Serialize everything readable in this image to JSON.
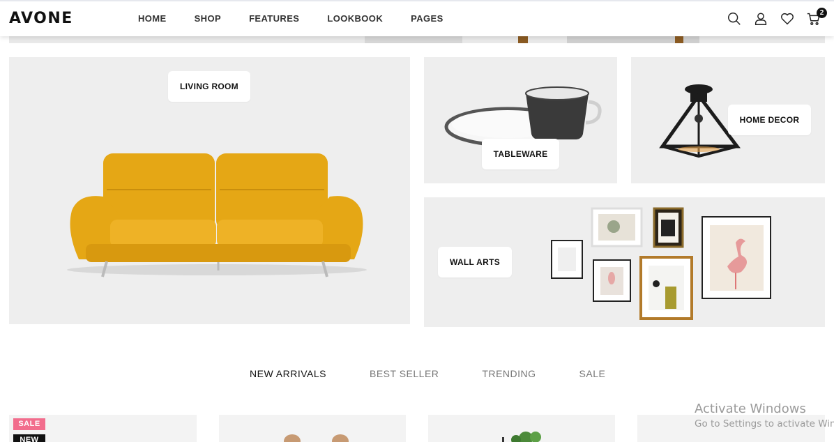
{
  "brand": {
    "logo": "AVONE"
  },
  "nav": [
    {
      "label": "HOME"
    },
    {
      "label": "SHOP"
    },
    {
      "label": "FEATURES"
    },
    {
      "label": "LOOKBOOK"
    },
    {
      "label": "PAGES"
    }
  ],
  "header_icons": [
    "search-icon",
    "user-icon",
    "heart-icon",
    "cart-icon"
  ],
  "cart": {
    "count": "2"
  },
  "categories": {
    "living_room": "LIVING ROOM",
    "tableware": "TABLEWARE",
    "home_decor": "HOME DECOR",
    "wall_arts": "WALL ARTS"
  },
  "tabs": [
    {
      "label": "NEW ARRIVALS",
      "active": true
    },
    {
      "label": "BEST SELLER",
      "active": false
    },
    {
      "label": "TRENDING",
      "active": false
    },
    {
      "label": "SALE",
      "active": false
    }
  ],
  "badges": {
    "sale": "SALE",
    "new": "NEW"
  },
  "watermark": {
    "title": "Activate Windows",
    "subtitle": "Go to Settings to activate Windows."
  },
  "colors": {
    "sofa": "#e5a715",
    "sale_badge": "#f26d8d",
    "tile_bg": "#eeeeee"
  }
}
